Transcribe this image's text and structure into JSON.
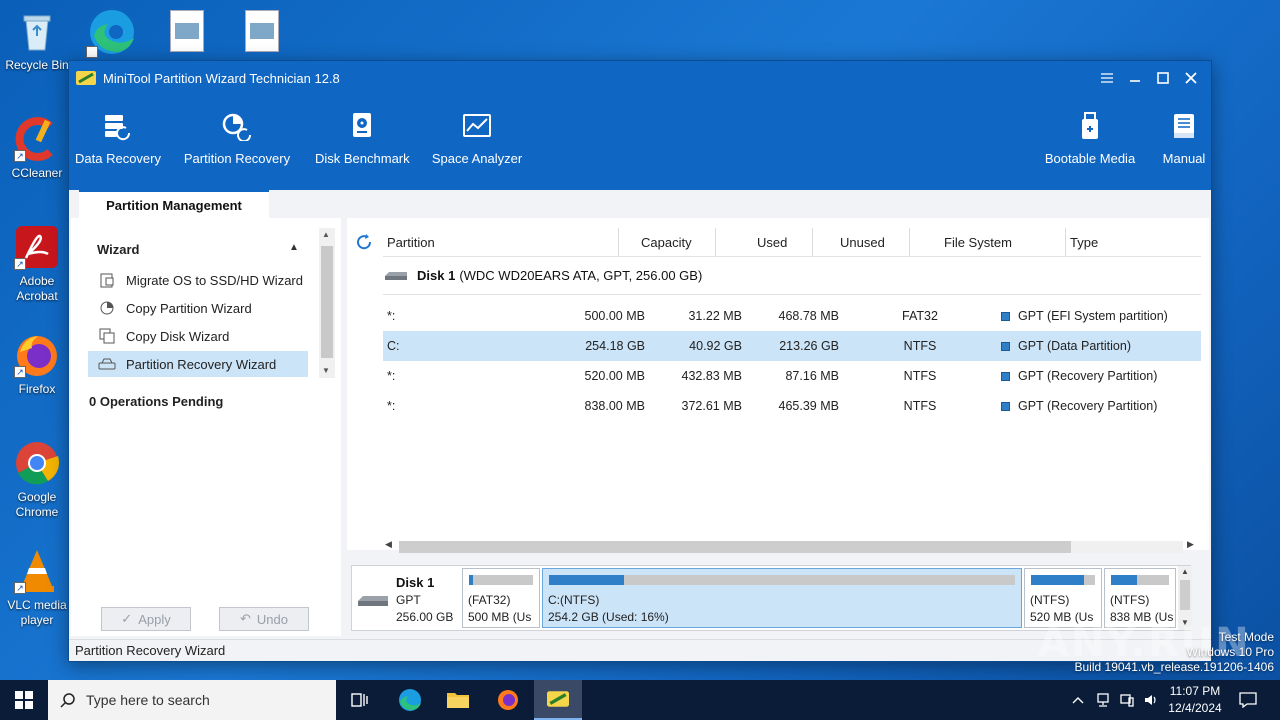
{
  "desktop": {
    "icons": [
      {
        "label": "Recycle Bin"
      },
      {
        "label": "CCleaner"
      },
      {
        "label": "Adobe Acrobat"
      },
      {
        "label": "Firefox"
      },
      {
        "label": "Google Chrome"
      },
      {
        "label": "VLC media player"
      }
    ]
  },
  "window": {
    "title": "MiniTool Partition Wizard Technician 12.8",
    "toolbar": {
      "data_recovery": "Data Recovery",
      "partition_recovery": "Partition Recovery",
      "disk_benchmark": "Disk Benchmark",
      "space_analyzer": "Space Analyzer",
      "bootable_media": "Bootable Media",
      "manual": "Manual"
    },
    "tab": "Partition Management",
    "left": {
      "wizard_heading": "Wizard",
      "items": [
        {
          "label": "Migrate OS to SSD/HD Wizard",
          "icon": "migrate-os-icon"
        },
        {
          "label": "Copy Partition Wizard",
          "icon": "copy-partition-icon"
        },
        {
          "label": "Copy Disk Wizard",
          "icon": "copy-disk-icon"
        },
        {
          "label": "Partition Recovery Wizard",
          "icon": "partition-recovery-icon",
          "selected": true
        }
      ],
      "operations_pending": "0 Operations Pending",
      "apply_label": "Apply",
      "undo_label": "Undo"
    },
    "table": {
      "columns": [
        "Partition",
        "Capacity",
        "Used",
        "Unused",
        "File System",
        "Type"
      ],
      "disk": {
        "name": "Disk 1",
        "details": "(WDC WD20EARS ATA, GPT, 256.00 GB)"
      },
      "rows": [
        {
          "partition": "*:",
          "capacity": "500.00 MB",
          "used": "31.22 MB",
          "unused": "468.78 MB",
          "fs": "FAT32",
          "type": "GPT (EFI System partition)"
        },
        {
          "partition": "C:",
          "capacity": "254.18 GB",
          "used": "40.92 GB",
          "unused": "213.26 GB",
          "fs": "NTFS",
          "type": "GPT (Data Partition)",
          "selected": true
        },
        {
          "partition": "*:",
          "capacity": "520.00 MB",
          "used": "432.83 MB",
          "unused": "87.16 MB",
          "fs": "NTFS",
          "type": "GPT (Recovery Partition)"
        },
        {
          "partition": "*:",
          "capacity": "838.00 MB",
          "used": "372.61 MB",
          "unused": "465.39 MB",
          "fs": "NTFS",
          "type": "GPT (Recovery Partition)"
        }
      ]
    },
    "diskmap": {
      "name": "Disk 1",
      "style": "GPT",
      "size": "256.00 GB",
      "segments": [
        {
          "line1": "(FAT32)",
          "line2": "500 MB (Us",
          "used_fraction": 0.06
        },
        {
          "line1": "C:(NTFS)",
          "line2": "254.2 GB (Used: 16%)",
          "used_fraction": 0.16,
          "selected": true
        },
        {
          "line1": "(NTFS)",
          "line2": "520 MB (Us",
          "used_fraction": 0.83
        },
        {
          "line1": "(NTFS)",
          "line2": "838 MB (Us",
          "used_fraction": 0.44
        }
      ]
    },
    "status": "Partition Recovery Wizard"
  },
  "watermark": {
    "line1": "Test Mode",
    "line2": "Windows 10 Pro",
    "line3": "Build 19041.vb_release.191206-1406",
    "brand": "ANY.RUN"
  },
  "taskbar": {
    "search_placeholder": "Type here to search",
    "time": "11:07 PM",
    "date": "12/4/2024"
  },
  "colors": {
    "accent": "#0f66c3",
    "selection": "#cce4f7",
    "used_bar": "#2f7fc8"
  }
}
